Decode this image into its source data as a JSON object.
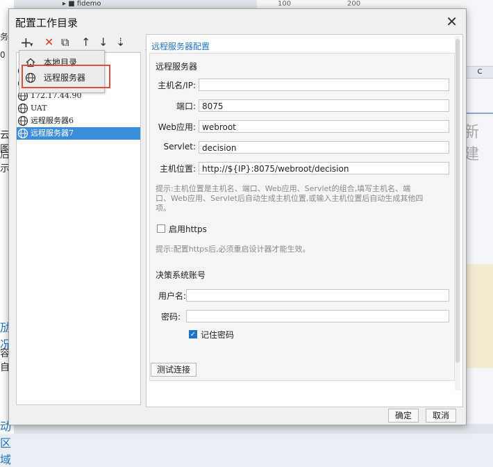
{
  "background": {
    "tree_item": "fidemo",
    "ruler_ticks": [
      "100",
      "200"
    ],
    "column_header": "C",
    "new_text": "新建",
    "left_fragments": [
      "务",
      "0",
      "云图",
      "后示",
      "劢况",
      "容自",
      "动区域"
    ]
  },
  "dialog": {
    "title": "配置工作目录",
    "close_symbol": "✕"
  },
  "toolbar": {
    "add": "+",
    "add_caret": "▾",
    "delete": "✕",
    "copy": "⧉",
    "up": "↑",
    "down": "↓",
    "sort": "⇣"
  },
  "menu": {
    "items": [
      {
        "label": "本地目录",
        "icon": "home-icon"
      },
      {
        "label": "远程服务器",
        "icon": "globe-icon"
      }
    ]
  },
  "tree": {
    "items": [
      {
        "label": "",
        "icon": "globe-icon",
        "selected": false
      },
      {
        "label": "",
        "icon": "globe-icon",
        "selected": false
      },
      {
        "label": "172.17.44.90",
        "icon": "globe-icon",
        "selected": false
      },
      {
        "label": "UAT",
        "icon": "globe-icon",
        "selected": false
      },
      {
        "label": "远程服务器6",
        "icon": "globe-icon",
        "selected": false
      },
      {
        "label": "远程服务器7",
        "icon": "globe-icon",
        "selected": true
      }
    ]
  },
  "form": {
    "section_title": "远程服务器配置",
    "server_heading": "远程服务器",
    "host_label": "主机名/IP:",
    "host_value": "",
    "port_label": "端口:",
    "port_value": "8075",
    "webapp_label": "Web应用:",
    "webapp_value": "webroot",
    "servlet_label": "Servlet:",
    "servlet_value": "decision",
    "location_label": "主机位置:",
    "location_value": "http://${IP}:8075/webroot/decision",
    "hint_location_line1": "提示:主机位置是主机名、端口、Web应用、Servlet的组合,填写主机名、端",
    "hint_location_line2": "口、Web应用、Servlet后自动生成主机位置,或输入主机位置后自动生成其他四",
    "hint_location_line3": "项。",
    "https_label": "启用https",
    "https_checked": false,
    "hint_https": "提示:配置https后,必须重启设计器才能生效。",
    "account_heading": "决策系统账号",
    "username_label": "用户名:",
    "username_value": "",
    "password_label": "密码:",
    "password_value": "",
    "remember_label": "记住密码",
    "remember_checked": true,
    "test_button": "测试连接"
  },
  "footer": {
    "ok_button": "确定",
    "cancel_button": "取消"
  },
  "colors": {
    "accent": "#1f74c0",
    "selection": "#3c8ddb",
    "highlight_border": "#e14b3b"
  }
}
